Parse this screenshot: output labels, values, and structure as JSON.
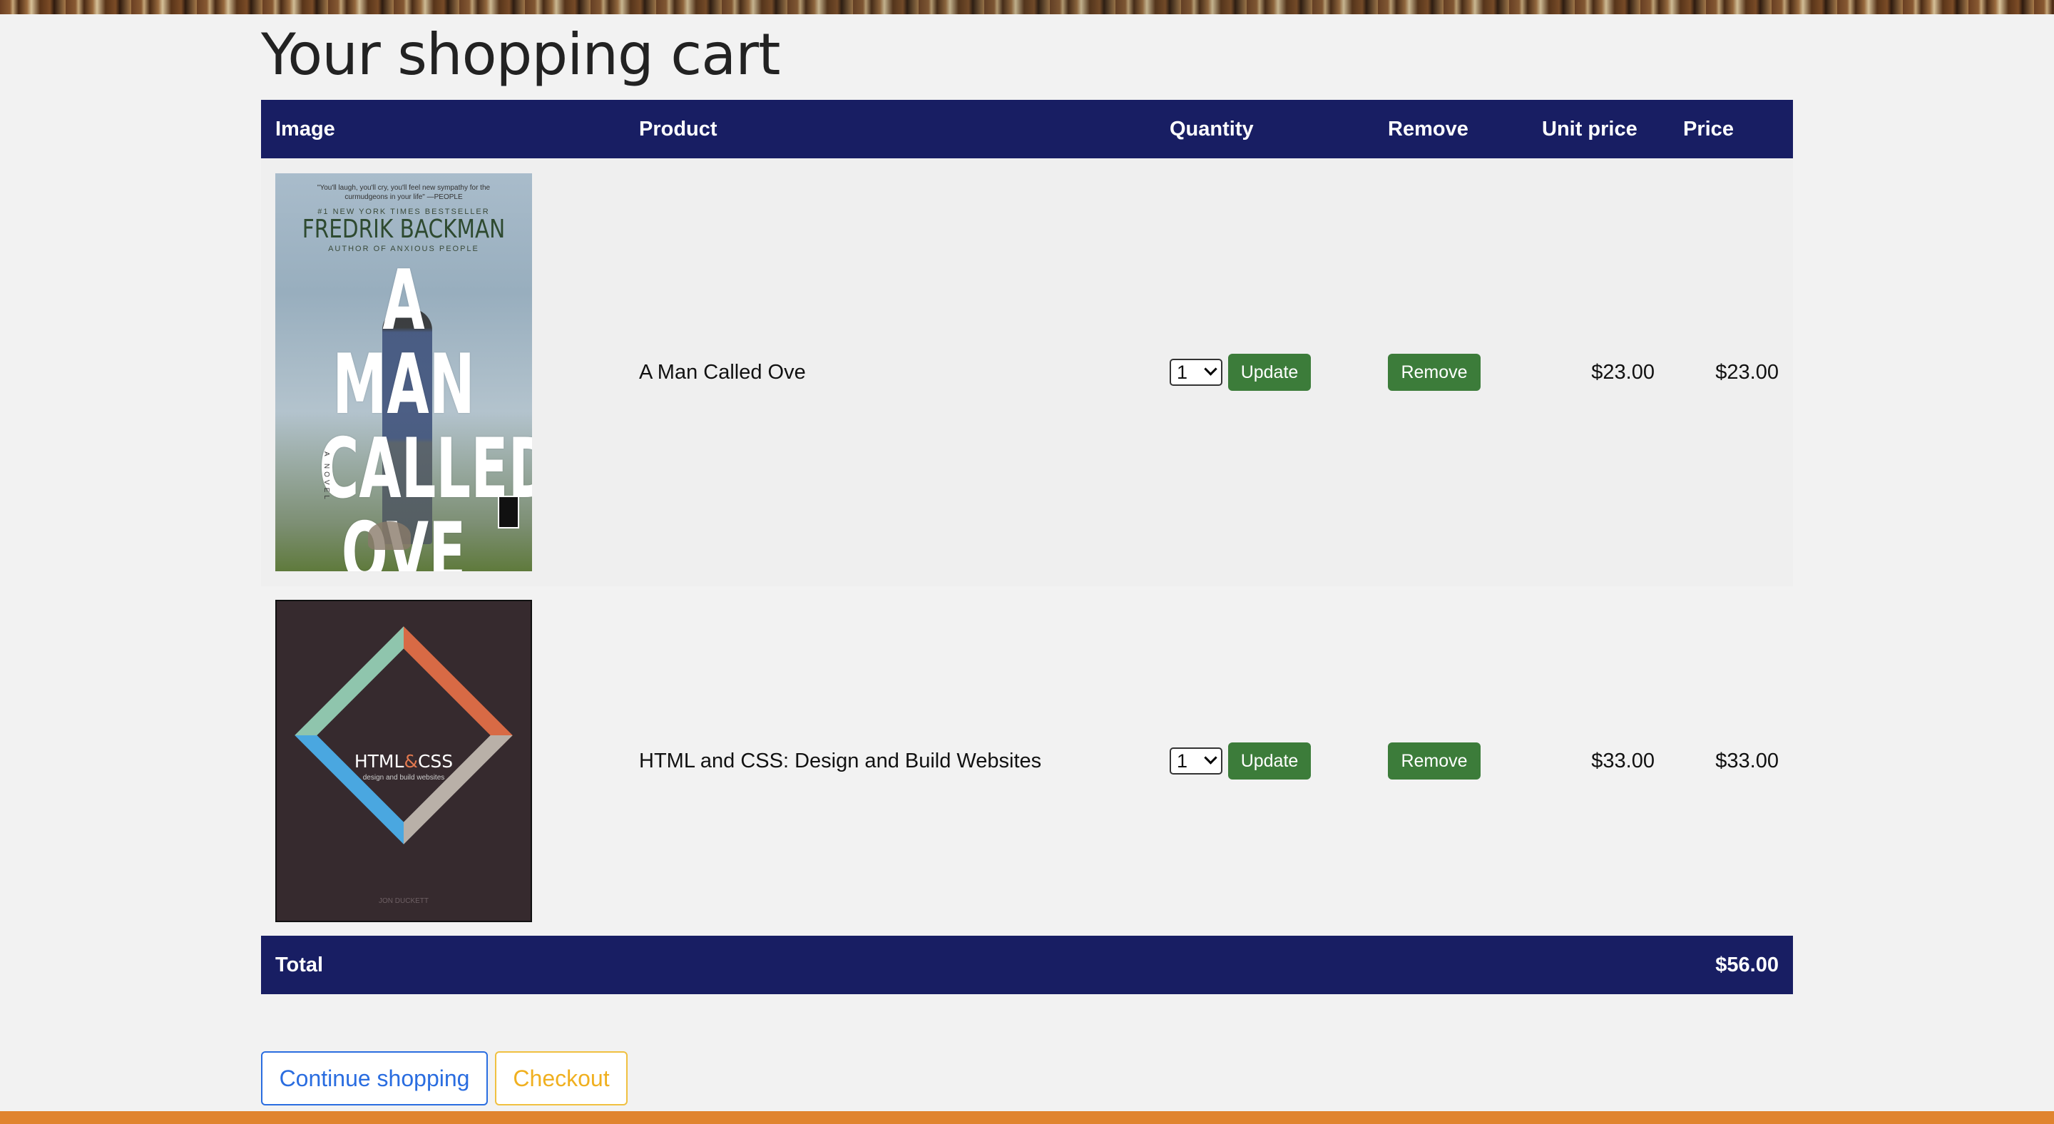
{
  "page": {
    "title": "Your shopping cart"
  },
  "table": {
    "headers": {
      "image": "Image",
      "product": "Product",
      "quantity": "Quantity",
      "remove": "Remove",
      "unit_price": "Unit price",
      "price": "Price"
    },
    "rows": [
      {
        "product": "A Man Called Ove",
        "quantity": "1",
        "update_label": "Update",
        "remove_label": "Remove",
        "unit_price": "$23.00",
        "price": "$23.00",
        "cover": {
          "quote": "\"You'll laugh, you'll cry, you'll feel new sympathy for the curmudgeons in your life\" —PEOPLE",
          "bestseller": "#1 NEW YORK TIMES BESTSELLER",
          "author": "FREDRIK BACKMAN",
          "author_of": "AUTHOR OF ANXIOUS PEOPLE",
          "title": "A MAN CALLED OVE",
          "novel": "A NOVEL"
        }
      },
      {
        "product": "HTML and CSS: Design and Build Websites",
        "quantity": "1",
        "update_label": "Update",
        "remove_label": "Remove",
        "unit_price": "$33.00",
        "price": "$33.00",
        "cover": {
          "title_html": "HTML",
          "title_amp": "&",
          "title_css": "CSS",
          "subtitle": "design and build websites",
          "author": "JON DUCKETT"
        }
      }
    ],
    "footer": {
      "label": "Total",
      "total": "$56.00"
    }
  },
  "actions": {
    "continue_label": "Continue shopping",
    "checkout_label": "Checkout"
  },
  "colors": {
    "header_bg": "#181e63",
    "button_green": "#3c7c3a",
    "continue_blue": "#2a6de0",
    "checkout_yellow": "#f0b020",
    "footer_bar": "#e0842f"
  }
}
